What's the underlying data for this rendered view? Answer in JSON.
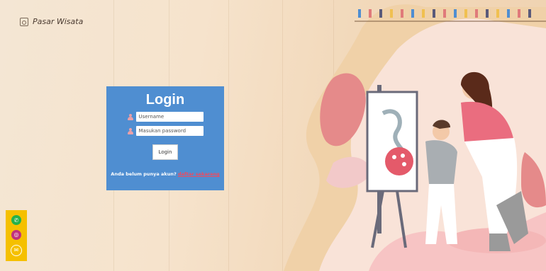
{
  "brand": {
    "name": "Pasar Wisata",
    "logo_icon": "house-icon"
  },
  "login": {
    "title": "Login",
    "username_placeholder": "Username",
    "password_placeholder": "Masukan password",
    "button_label": "Login",
    "signup_prompt": "Anda belum punya akun?",
    "signup_link": "daftar sekarang"
  },
  "social": {
    "items": [
      {
        "icon": "whatsapp-icon",
        "color": "#25b14b"
      },
      {
        "icon": "instagram-icon",
        "color": "#c0317c"
      },
      {
        "icon": "email-icon",
        "color": "#f5c000"
      }
    ]
  },
  "colors": {
    "card": "#4f8ed1",
    "link": "#f04a5e",
    "social_bar": "#f5c000"
  }
}
